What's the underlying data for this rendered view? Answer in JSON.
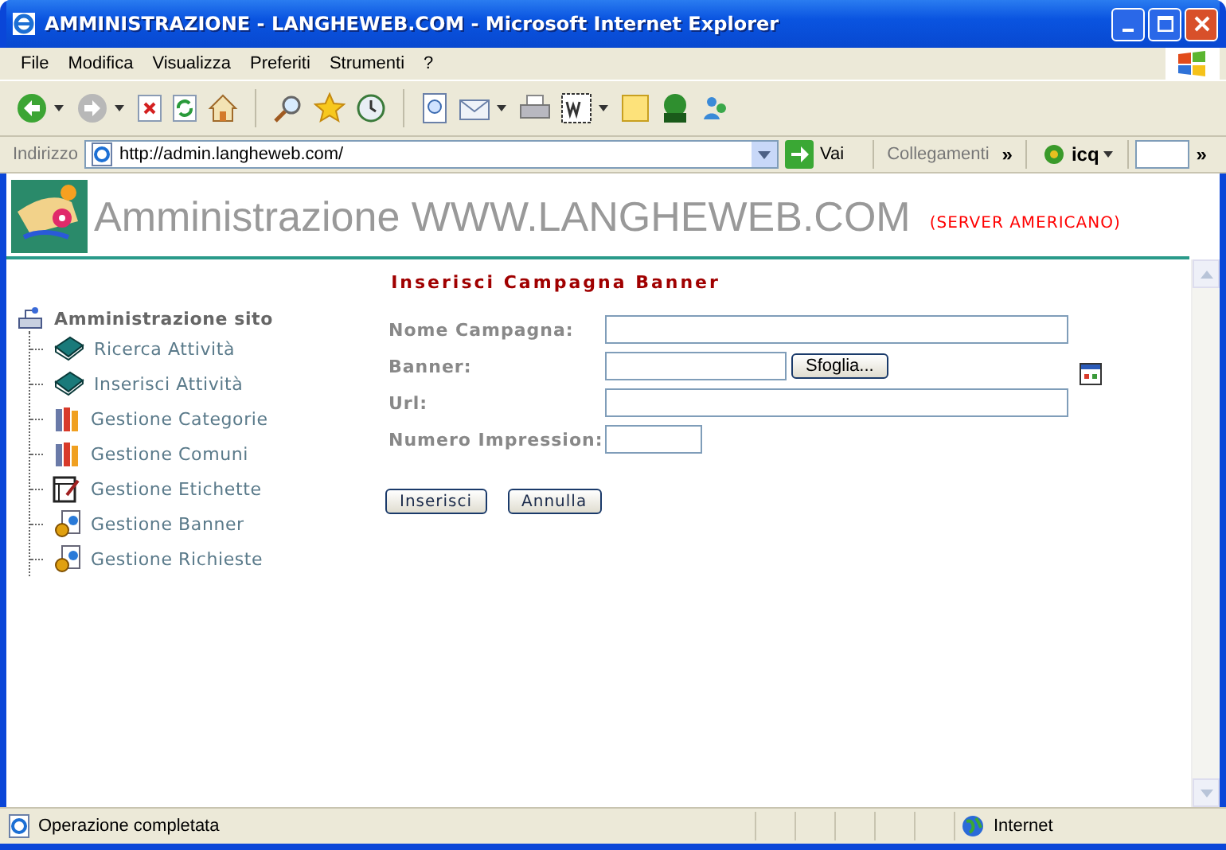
{
  "window": {
    "title": "AMMINISTRAZIONE - LANGHEWEB.COM - Microsoft Internet Explorer"
  },
  "menu_bar": [
    "File",
    "Modifica",
    "Visualizza",
    "Preferiti",
    "Strumenti",
    "?"
  ],
  "address_bar": {
    "label": "Indirizzo",
    "value": "http://admin.langheweb.com/",
    "go_label": "Vai",
    "links_label": "Collegamenti",
    "chevron": "»",
    "toolbar_label": "icq",
    "chevron_2": "»"
  },
  "header": {
    "title": "Amministrazione WWW.LANGHEWEB.COM",
    "subtitle": "(SERVER AMERICANO)"
  },
  "page_title": "Inserisci Campagna Banner",
  "sidebar": {
    "heading": "Amministrazione sito",
    "items": [
      {
        "label": "Ricerca Attività",
        "kind": "book"
      },
      {
        "label": "Inserisci Attività",
        "kind": "book"
      },
      {
        "label": "Gestione Categorie",
        "kind": "binders"
      },
      {
        "label": "Gestione Comuni",
        "kind": "binders"
      },
      {
        "label": "Gestione Etichette",
        "kind": "note"
      },
      {
        "label": "Gestione Banner",
        "kind": "gear"
      },
      {
        "label": "Gestione Richieste",
        "kind": "gear"
      }
    ]
  },
  "form": {
    "fields": [
      {
        "label": "Nome Campagna:",
        "kind": "wide"
      },
      {
        "label": "Banner:",
        "kind": "file",
        "button": "Sfoglia..."
      },
      {
        "label": "Url:",
        "kind": "wide"
      },
      {
        "label": "Numero Impression:",
        "kind": "short"
      }
    ],
    "buttons": [
      "Inserisci",
      "Annulla"
    ]
  },
  "status_bar": {
    "text": "Operazione completata",
    "zone": "Internet"
  }
}
